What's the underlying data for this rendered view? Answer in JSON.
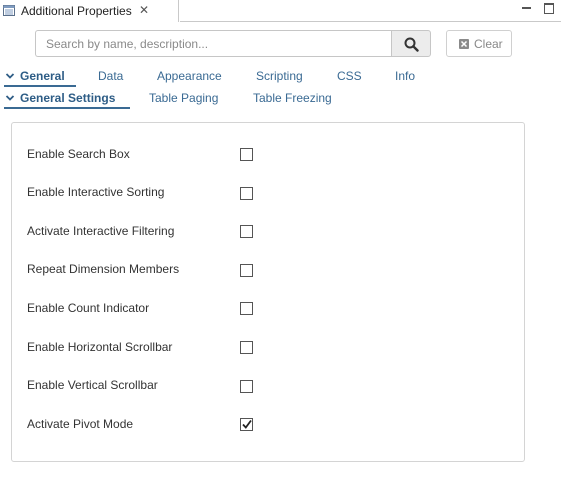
{
  "window": {
    "tab_title": "Additional Properties",
    "tab_icon": "properties-table-icon",
    "close_glyph": "✕"
  },
  "search": {
    "placeholder": "Search by name, description...",
    "value": "",
    "clear_label": "Clear"
  },
  "tabs": [
    {
      "label": "General",
      "active": true
    },
    {
      "label": "Data",
      "active": false
    },
    {
      "label": "Appearance",
      "active": false
    },
    {
      "label": "Scripting",
      "active": false
    },
    {
      "label": "CSS",
      "active": false
    },
    {
      "label": "Info",
      "active": false
    }
  ],
  "subtabs": [
    {
      "label": "General Settings",
      "active": true
    },
    {
      "label": "Table Paging",
      "active": false
    },
    {
      "label": "Table Freezing",
      "active": false
    }
  ],
  "properties": [
    {
      "label": "Enable Search Box",
      "checked": false
    },
    {
      "label": "Enable Interactive Sorting",
      "checked": false
    },
    {
      "label": "Activate Interactive Filtering",
      "checked": false
    },
    {
      "label": "Repeat Dimension Members",
      "checked": false
    },
    {
      "label": "Enable Count Indicator",
      "checked": false
    },
    {
      "label": "Enable Horizontal Scrollbar",
      "checked": false
    },
    {
      "label": "Enable Vertical Scrollbar",
      "checked": false
    },
    {
      "label": "Activate Pivot Mode",
      "checked": true
    }
  ],
  "colors": {
    "accent": "#3a6a93",
    "border": "#d4d4d4"
  }
}
